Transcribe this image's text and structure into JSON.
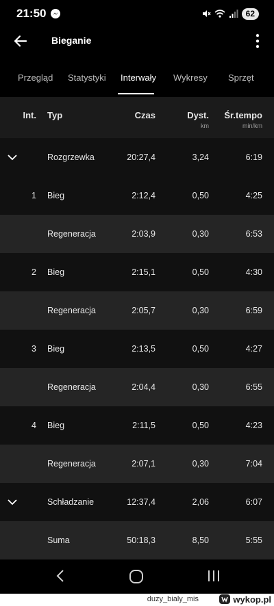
{
  "status": {
    "time": "21:50",
    "battery": "62"
  },
  "appbar": {
    "title": "Bieganie"
  },
  "tabs": [
    {
      "label": "Przegląd"
    },
    {
      "label": "Statystyki"
    },
    {
      "label": "Interwały"
    },
    {
      "label": "Wykresy"
    },
    {
      "label": "Sprzęt"
    }
  ],
  "active_tab": "Interwały",
  "table": {
    "headers": {
      "int": "Int.",
      "typ": "Typ",
      "czas": "Czas",
      "dyst": "Dyst.",
      "dyst_unit": "km",
      "tempo": "Śr.tempo",
      "tempo_unit": "min/km"
    },
    "rows": [
      {
        "int": "",
        "typ": "Rozgrzewka",
        "czas": "20:27,4",
        "dyst": "3,24",
        "tempo": "6:19",
        "expand": true
      },
      {
        "int": "1",
        "typ": "Bieg",
        "czas": "2:12,4",
        "dyst": "0,50",
        "tempo": "4:25"
      },
      {
        "int": "",
        "typ": "Regeneracja",
        "czas": "2:03,9",
        "dyst": "0,30",
        "tempo": "6:53"
      },
      {
        "int": "2",
        "typ": "Bieg",
        "czas": "2:15,1",
        "dyst": "0,50",
        "tempo": "4:30"
      },
      {
        "int": "",
        "typ": "Regeneracja",
        "czas": "2:05,7",
        "dyst": "0,30",
        "tempo": "6:59"
      },
      {
        "int": "3",
        "typ": "Bieg",
        "czas": "2:13,5",
        "dyst": "0,50",
        "tempo": "4:27"
      },
      {
        "int": "",
        "typ": "Regeneracja",
        "czas": "2:04,4",
        "dyst": "0,30",
        "tempo": "6:55"
      },
      {
        "int": "4",
        "typ": "Bieg",
        "czas": "2:11,5",
        "dyst": "0,50",
        "tempo": "4:23"
      },
      {
        "int": "",
        "typ": "Regeneracja",
        "czas": "2:07,1",
        "dyst": "0,30",
        "tempo": "7:04"
      },
      {
        "int": "",
        "typ": "Schładzanie",
        "czas": "12:37,4",
        "dyst": "2,06",
        "tempo": "6:07",
        "expand": true
      },
      {
        "int": "",
        "typ": "Suma",
        "czas": "50:18,3",
        "dyst": "8,50",
        "tempo": "5:55"
      }
    ]
  },
  "watermark": {
    "user": "duzy_bialy_mis",
    "site": "wykop.pl"
  },
  "colors": {
    "background": "#000000",
    "row_dark": "#111111",
    "row_light": "#252525",
    "header_bg": "#1b1b1b"
  }
}
